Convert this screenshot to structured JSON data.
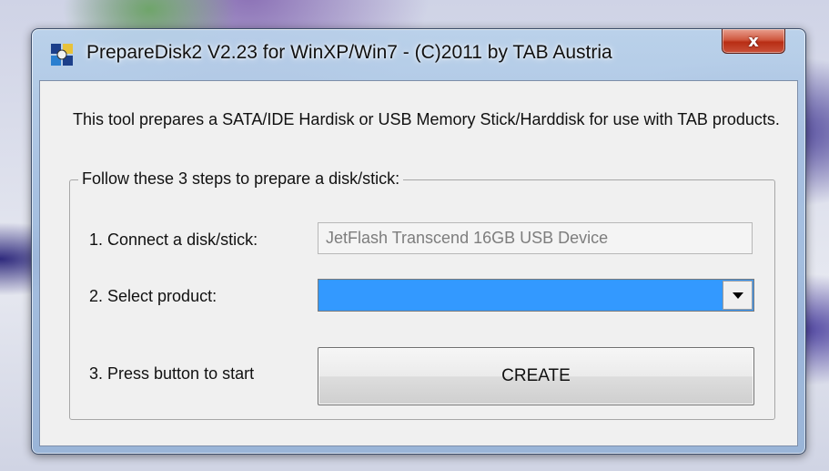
{
  "window": {
    "title": "PrepareDisk2 V2.23 for WinXP/Win7 - (C)2011 by TAB Austria",
    "close_label": "x"
  },
  "intro": "This tool prepares a SATA/IDE Hardisk or USB Memory Stick/Harddisk for use with TAB products.",
  "group": {
    "legend": "Follow these 3 steps to prepare a disk/stick:",
    "steps": [
      {
        "label": "1. Connect a disk/stick:",
        "value": "JetFlash Transcend 16GB USB Device"
      },
      {
        "label": "2. Select product:",
        "value": ""
      },
      {
        "label": "3. Press button to start",
        "button": "CREATE"
      }
    ]
  },
  "colors": {
    "selection_highlight": "#3399ff",
    "close_button": "#c9513a"
  },
  "icons": [
    "app-icon",
    "close-icon",
    "dropdown-arrow-icon"
  ]
}
